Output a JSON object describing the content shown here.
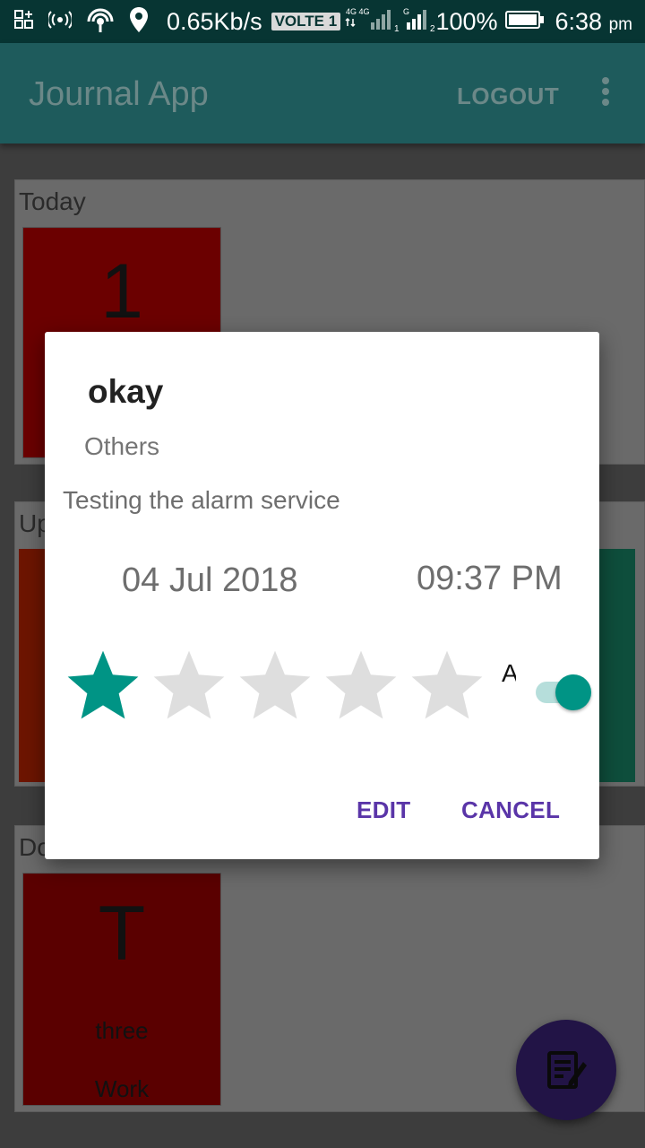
{
  "status_bar": {
    "speed": "0.65Kb/s",
    "volte": "VOLTE 1",
    "battery": "100%",
    "time": "6:38",
    "time_suffix": "pm",
    "icons": [
      "screenshot-icon",
      "hotspot-icon",
      "wifi-icon",
      "location-icon",
      "signal-icon",
      "battery-icon"
    ]
  },
  "app_bar": {
    "title": "Journal App",
    "logout_label": "LOGOUT",
    "menu_icon": "overflow-menu-icon"
  },
  "sections": [
    {
      "title": "Today",
      "tile_letter": "1",
      "tile_color": "#6b0000"
    },
    {
      "title": "Up",
      "tile_colors": [
        "#6d1500",
        "#0e4e3c"
      ]
    },
    {
      "title": "Do",
      "tile_letter": "T",
      "tile_title": "three",
      "tile_category": "Work",
      "tile_color": "#5a0000"
    }
  ],
  "dialog": {
    "title": "okay",
    "category": "Others",
    "description": "Testing the alarm service",
    "date": "04 Jul 2018",
    "time": "09:37 PM",
    "rating": 1,
    "rating_max": 5,
    "switch_label": "Al",
    "alarm_enabled": true,
    "edit_label": "EDIT",
    "cancel_label": "CANCEL"
  },
  "colors": {
    "accent": "#009485",
    "dialog_button": "#5a35a8",
    "fab": "#221446",
    "star_empty": "#dedede"
  },
  "fab": {
    "icon": "edit-note-icon"
  }
}
